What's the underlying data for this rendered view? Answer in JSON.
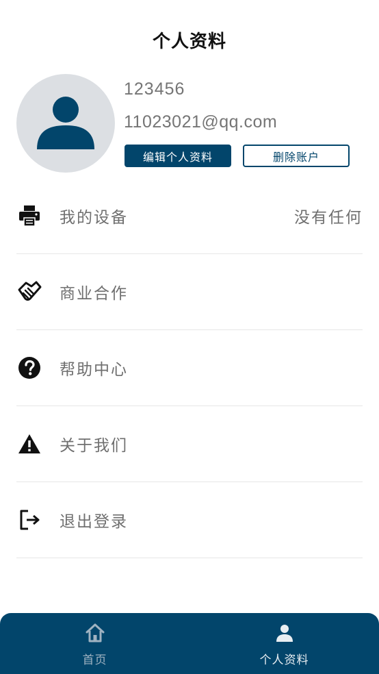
{
  "header": {
    "title": "个人资料"
  },
  "profile": {
    "username": "123456",
    "email": "11023021@qq.com",
    "edit_button": "编辑个人资料",
    "delete_button": "删除账户"
  },
  "menu": [
    {
      "icon": "printer-icon",
      "label": "我的设备",
      "value": "没有任何"
    },
    {
      "icon": "handshake-icon",
      "label": "商业合作"
    },
    {
      "icon": "help-circle-icon",
      "label": "帮助中心"
    },
    {
      "icon": "warning-icon",
      "label": "关于我们"
    },
    {
      "icon": "logout-icon",
      "label": "退出登录"
    }
  ],
  "bottom_nav": {
    "home": {
      "icon": "home-icon",
      "label": "首页"
    },
    "profile": {
      "icon": "user-icon",
      "label": "个人资料"
    }
  },
  "colors": {
    "primary": "#02456b",
    "avatar_bg": "#dcdfe3",
    "text_gray": "#6f6f6f"
  }
}
